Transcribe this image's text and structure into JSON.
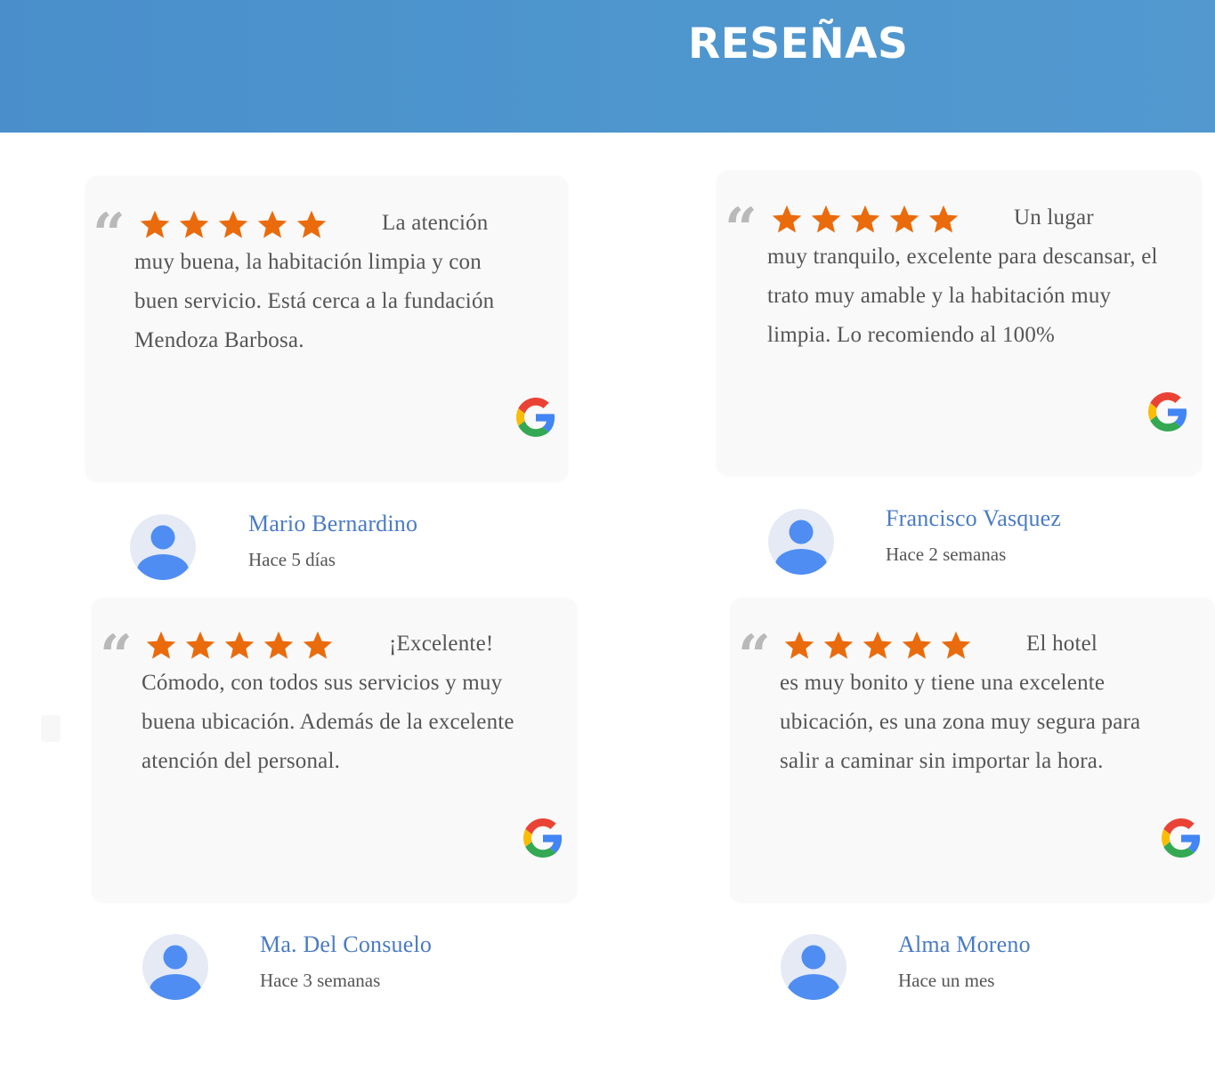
{
  "header": {
    "title": "RESEÑAS"
  },
  "colors": {
    "header_bg": "#4d95cd",
    "star": "#ea6b0c",
    "name": "#4a7bc4",
    "card_bg": "#f9f9f9"
  },
  "quote_mark": "“",
  "reviews": [
    {
      "rating": 5,
      "first_line": "La atención",
      "text": "muy buena, la habitación limpia y con\nbuen servicio. Está cerca a la fundación\nMendoza Barbosa.",
      "author": "Mario Bernardino",
      "time": "Hace 5 días",
      "source_icon": "google-icon",
      "avatar_icon": "user-avatar-icon"
    },
    {
      "rating": 5,
      "first_line": "Un lugar",
      "text": "muy tranquilo, excelente para descansar, el\ntrato muy amable y la habitación muy\nlimpia. Lo recomiendo al 100%",
      "author": "Francisco Vasquez",
      "time": "Hace 2 semanas",
      "source_icon": "google-icon",
      "avatar_icon": "user-avatar-icon"
    },
    {
      "rating": 5,
      "first_line": "¡Excelente!",
      "text": "Cómodo, con todos sus servicios y muy\nbuena ubicación. Además de la excelente\natención del personal.",
      "author": "Ma. Del Consuelo",
      "time": "Hace 3 semanas",
      "source_icon": "google-icon",
      "avatar_icon": "user-avatar-icon"
    },
    {
      "rating": 5,
      "first_line": "El hotel",
      "text": "es muy bonito y tiene una excelente\nubicación, es una zona muy segura para\nsalir a caminar sin importar la hora.",
      "author": "Alma Moreno",
      "time": "Hace un mes",
      "source_icon": "google-icon",
      "avatar_icon": "user-avatar-icon"
    }
  ]
}
